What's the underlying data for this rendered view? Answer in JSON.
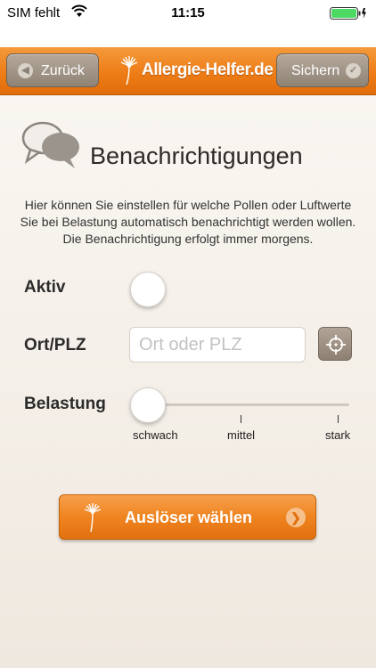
{
  "status_bar": {
    "carrier": "SIM fehlt",
    "time": "11:15",
    "battery_level": 1.0
  },
  "nav": {
    "back_label": "Zurück",
    "save_label": "Sichern",
    "brand": "Allergie-Helfer.de"
  },
  "header": {
    "title": "Benachrichtigungen",
    "description": "Hier können Sie einstellen für welche Pollen oder Luftwerte Sie bei Belastung automatisch benachrichtigt werden wollen. Die Benachrichtigung erfolgt immer morgens."
  },
  "form": {
    "aktiv_label": "Aktiv",
    "aktiv_value": false,
    "ort_label": "Ort/PLZ",
    "ort_placeholder": "Ort oder PLZ",
    "ort_value": "",
    "belastung_label": "Belastung",
    "belastung_value": 0,
    "belastung_ticks": [
      "schwach",
      "mittel",
      "stark"
    ]
  },
  "trigger_button": {
    "label": "Auslöser wählen"
  },
  "colors": {
    "accent": "#ee7d17",
    "nav_button": "#8f8376"
  }
}
